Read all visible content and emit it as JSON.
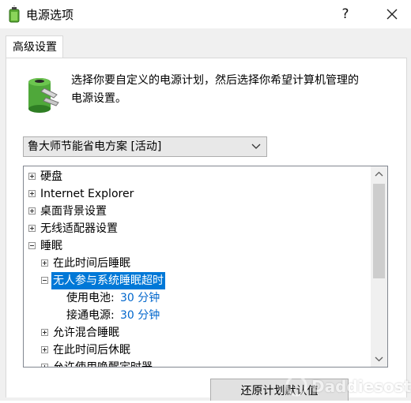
{
  "window": {
    "title": "电源选项",
    "help_label": "?",
    "close_label": "✕"
  },
  "tabs": [
    {
      "label": "高级设置",
      "active": true
    }
  ],
  "intro": {
    "line1": "选择你要自定义的电源计划，然后选择你希望计算机管理的",
    "line2": "电源设置。"
  },
  "plan_select": {
    "value": "鲁大师节能省电方案 [活动]"
  },
  "tree": {
    "items": [
      {
        "label": "硬盘",
        "expander": "plus",
        "level": 0
      },
      {
        "label": "Internet Explorer",
        "expander": "plus",
        "level": 0
      },
      {
        "label": "桌面背景设置",
        "expander": "plus",
        "level": 0
      },
      {
        "label": "无线适配器设置",
        "expander": "plus",
        "level": 0
      },
      {
        "label": "睡眠",
        "expander": "minus",
        "level": 0
      },
      {
        "label": "在此时间后睡眠",
        "expander": "plus",
        "level": 1
      },
      {
        "label": "无人参与系统睡眠超时",
        "expander": "minus",
        "level": 1,
        "selected": true
      },
      {
        "label": "使用电池:",
        "value": "30 分钟",
        "level": 2
      },
      {
        "label": "接通电源:",
        "value": "30 分钟",
        "level": 2
      },
      {
        "label": "允许混合睡眠",
        "expander": "plus",
        "level": 1
      },
      {
        "label": "在此时间后休眠",
        "expander": "plus",
        "level": 1
      },
      {
        "label": "允许使用唤醒定时器",
        "expander": "plus",
        "level": 1
      }
    ]
  },
  "buttons": {
    "restore": "还原计划默认值"
  },
  "watermark": "Daddiesost"
}
